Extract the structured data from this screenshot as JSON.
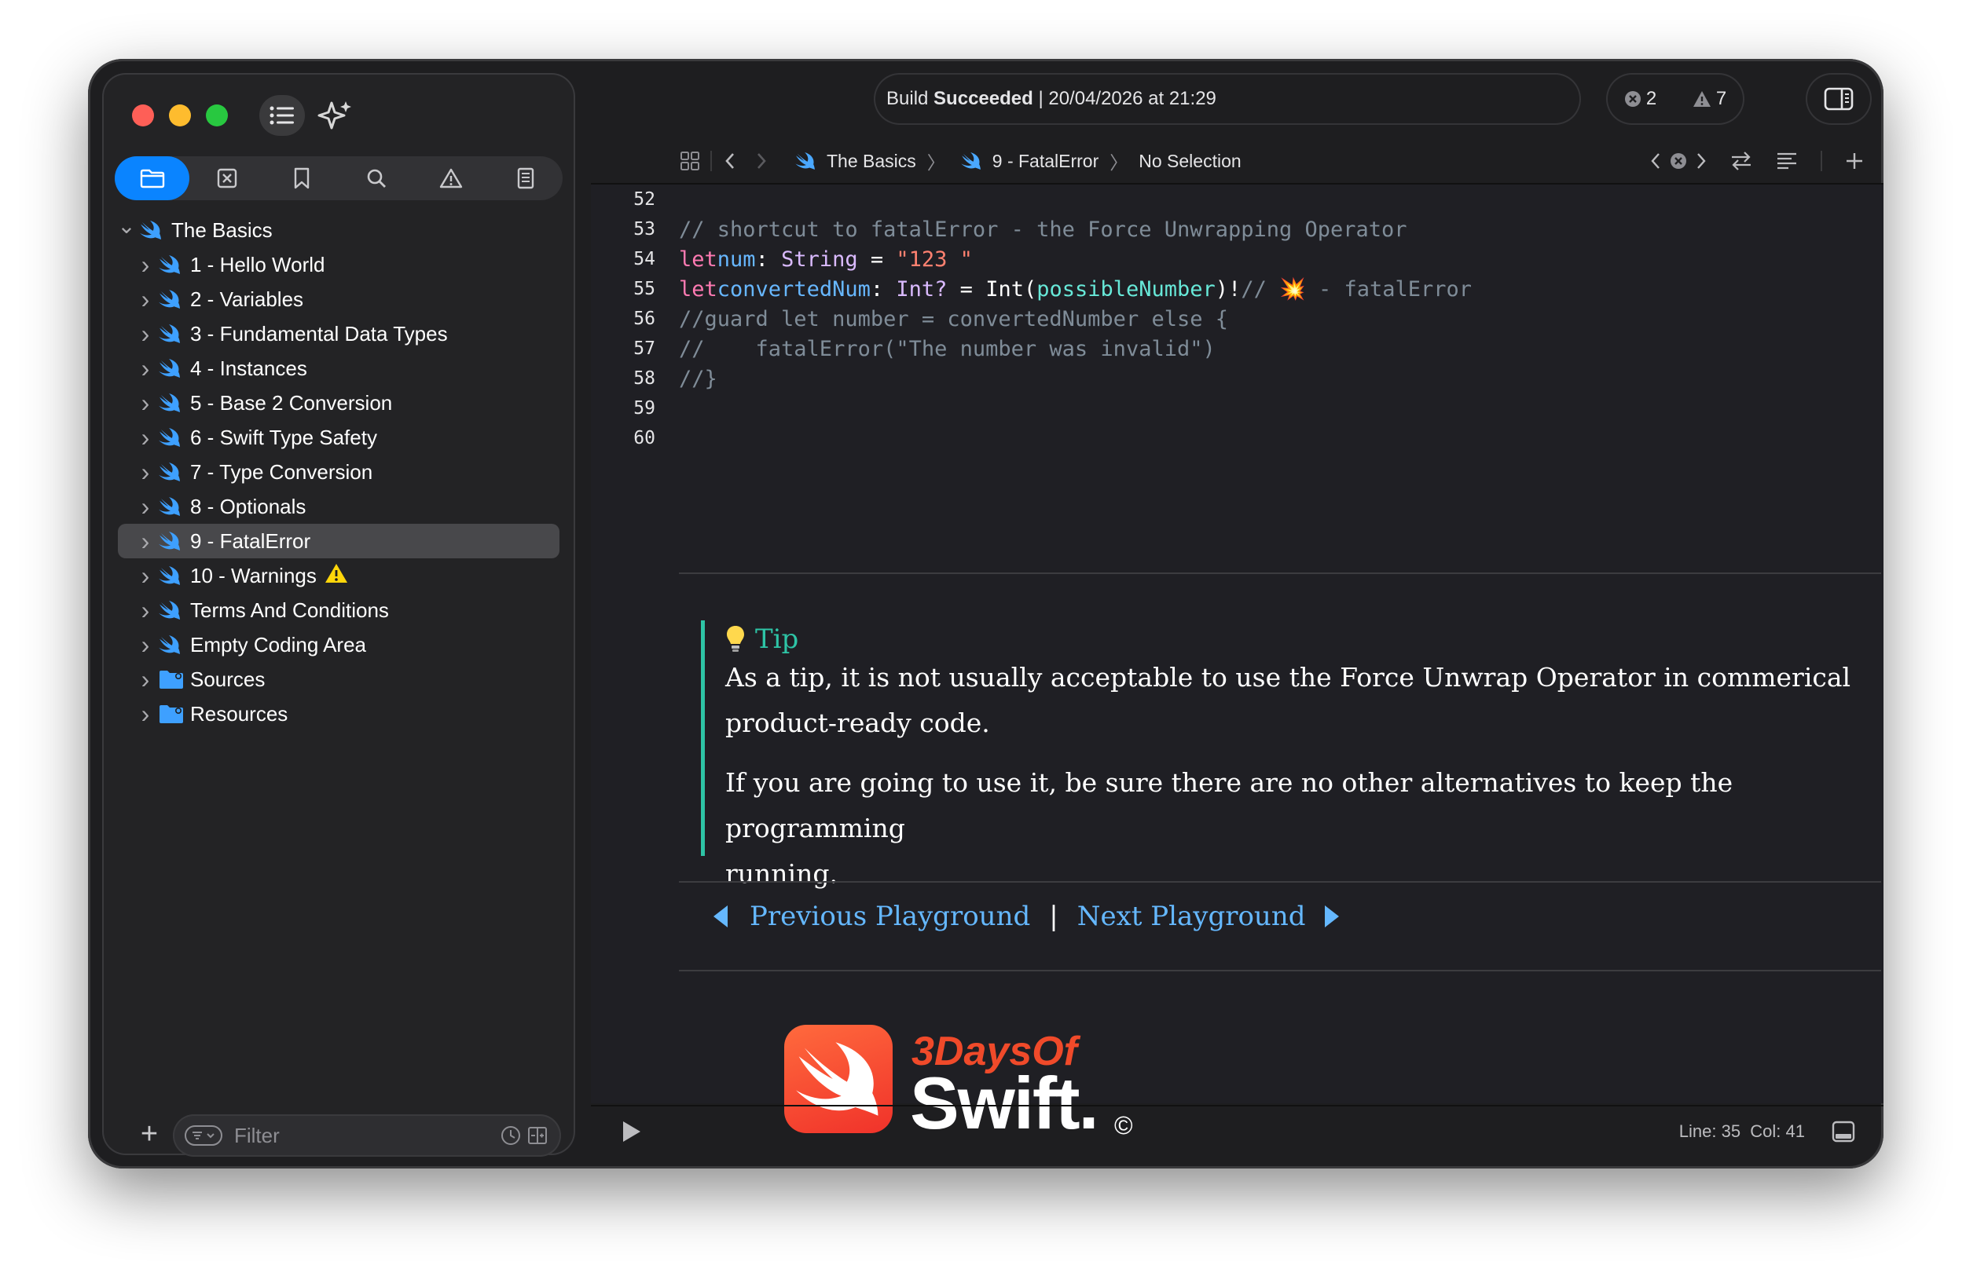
{
  "window": {
    "build_status_prefix": "Build",
    "build_status_result": "Succeeded",
    "build_status_time": "| 20/04/2026 at 21:29",
    "errors_count": "2",
    "warnings_count": "7"
  },
  "navigator": {
    "tree": [
      {
        "label": "The Basics",
        "kind": "root"
      },
      {
        "label": "1 - Hello World",
        "kind": "swift"
      },
      {
        "label": "2 - Variables",
        "kind": "swift"
      },
      {
        "label": "3 - Fundamental Data Types",
        "kind": "swift"
      },
      {
        "label": "4 - Instances",
        "kind": "swift"
      },
      {
        "label": "5 - Base 2 Conversion",
        "kind": "swift"
      },
      {
        "label": "6 - Swift Type Safety",
        "kind": "swift"
      },
      {
        "label": "7 - Type Conversion",
        "kind": "swift"
      },
      {
        "label": "8 - Optionals",
        "kind": "swift"
      },
      {
        "label": "9 - FatalError",
        "kind": "swift",
        "selected": true
      },
      {
        "label": "10 - Warnings",
        "kind": "swift",
        "warning": true
      },
      {
        "label": "Terms And Conditions",
        "kind": "swift"
      },
      {
        "label": "Empty Coding Area",
        "kind": "swift"
      },
      {
        "label": "Sources",
        "kind": "folder"
      },
      {
        "label": "Resources",
        "kind": "folder"
      }
    ],
    "filter_placeholder": "Filter"
  },
  "jumpbar": {
    "crumbs": [
      "The Basics",
      "9 - FatalError",
      "No Selection"
    ]
  },
  "editor": {
    "line_numbers": [
      "52",
      "53",
      "54",
      "55",
      "56",
      "57",
      "58",
      "59",
      "60"
    ],
    "code": {
      "l53": "// shortcut to fatalError - the Force Unwrapping Operator",
      "l54_kw": "let",
      "l54_var": "num",
      "l54_type": "String",
      "l54_str": "\"123 \"",
      "l55_kw": "let",
      "l55_var": "convertedNum",
      "l55_type": "Int?",
      "l55_fn": "Int(",
      "l55_arg": "possibleNumber",
      "l55_rest": ")!",
      "l55_comment": "// 💥 - fatalError",
      "l56": "//guard let number = convertedNumber else {",
      "l57": "//    fatalError(\"The number was invalid\")",
      "l58": "//}"
    }
  },
  "doc": {
    "tip_title": "Tip",
    "tip_p1_line1": "As a tip, it is not usually acceptable to use the Force Unwrap Operator in commerical",
    "tip_p1_line2": "product-ready code.",
    "tip_p2_line1": "If you are going to use it, be sure there are no other alternatives to keep the programming",
    "tip_p2_line2": "running.",
    "prev_link": "Previous Playground",
    "separator": "|",
    "next_link": "Next Playground",
    "logo_top": "3DaysOf",
    "logo_big": "Swift.",
    "copyright": "©"
  },
  "statusbar": {
    "position": "Line: 35  Col: 41"
  },
  "colors": {
    "accent": "#0a84ff",
    "tip": "#2ec4a6",
    "link": "#65b8ff",
    "keyword": "#ff7ab2",
    "string": "#ff8170"
  }
}
